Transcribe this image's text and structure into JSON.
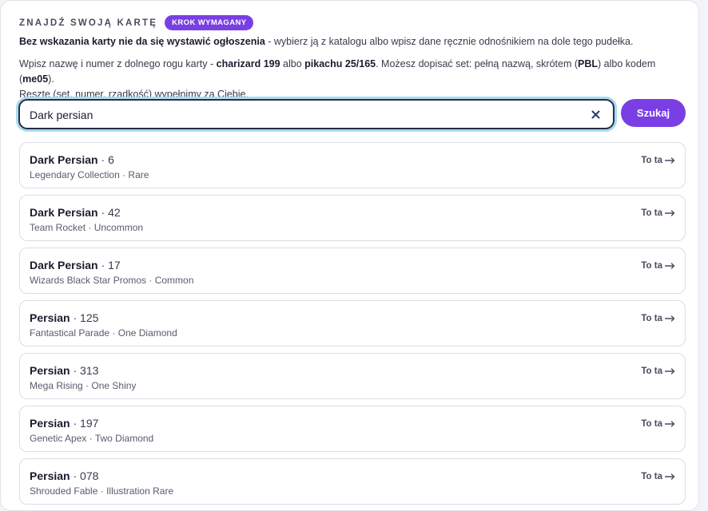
{
  "header": {
    "title": "ZNAJDŹ SWOJĄ KARTĘ",
    "badge": "KROK WYMAGANY"
  },
  "intro": {
    "line1_bold": "Bez wskazania karty nie da się wystawić ogłoszenia",
    "line1_rest": " - wybierz ją z katalogu albo wpisz dane ręcznie odnośnikiem na dole tego pudełka.",
    "line2_a": "Wpisz nazwę i numer z dolnego rogu karty - ",
    "line2_b1": "charizard 199",
    "line2_c": " albo ",
    "line2_b2": "pikachu 25/165",
    "line2_d": ". Możesz dopisać set: pełną nazwą, skrótem (",
    "line2_b3": "PBL",
    "line2_e": ") albo kodem (",
    "line2_b4": "me05",
    "line2_f": ").",
    "line3": "Resztę (set, numer, rzadkość) wypełnimy za Ciebie."
  },
  "search": {
    "value": "Dark persian",
    "button_label": "Szukaj"
  },
  "results": [
    {
      "name": "Dark Persian",
      "number": "6",
      "set": "Legendary Collection",
      "rarity": "Rare",
      "cta": "To ta"
    },
    {
      "name": "Dark Persian",
      "number": "42",
      "set": "Team Rocket",
      "rarity": "Uncommon",
      "cta": "To ta"
    },
    {
      "name": "Dark Persian",
      "number": "17",
      "set": "Wizards Black Star Promos",
      "rarity": "Common",
      "cta": "To ta"
    },
    {
      "name": "Persian",
      "number": "125",
      "set": "Fantastical Parade",
      "rarity": "One Diamond",
      "cta": "To ta"
    },
    {
      "name": "Persian",
      "number": "313",
      "set": "Mega Rising",
      "rarity": "One Shiny",
      "cta": "To ta"
    },
    {
      "name": "Persian",
      "number": "197",
      "set": "Genetic Apex",
      "rarity": "Two Diamond",
      "cta": "To ta"
    },
    {
      "name": "Persian",
      "number": "078",
      "set": "Shrouded Fable",
      "rarity": "Illustration Rare",
      "cta": "To ta"
    }
  ],
  "colors": {
    "accent": "#7a3fe4",
    "focus_ring": "#a6dcf0"
  },
  "icons": {
    "clear": "close-icon",
    "cta_arrow": "arrow-right-icon"
  }
}
